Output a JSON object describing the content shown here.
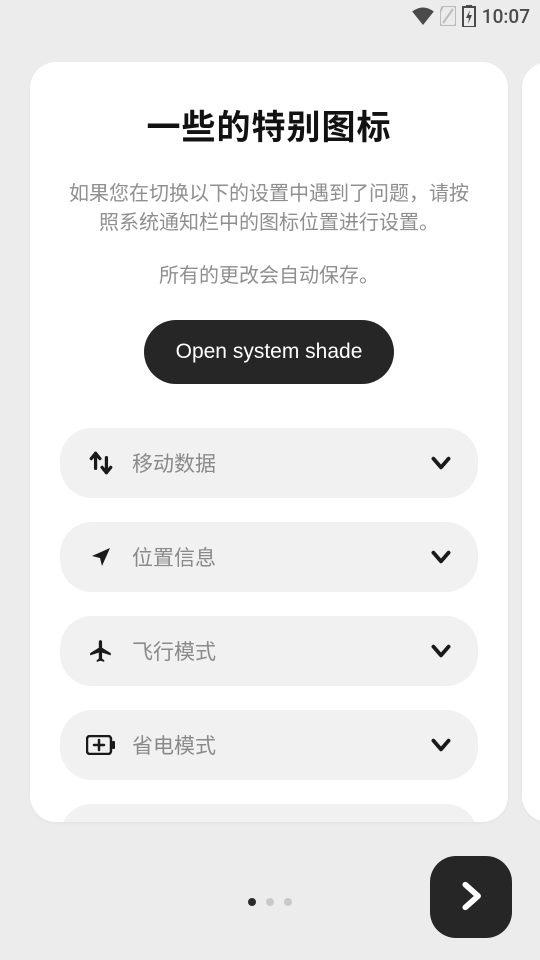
{
  "status": {
    "time": "10:07"
  },
  "card": {
    "title": "一些的特别图标",
    "desc1": "如果您在切换以下的设置中遇到了问题，请按照系统通知栏中的图标位置进行设置。",
    "desc2": "所有的更改会自动保存。",
    "open_label": "Open system shade"
  },
  "rows": [
    {
      "label": "移动数据"
    },
    {
      "label": "位置信息"
    },
    {
      "label": "飞行模式"
    },
    {
      "label": "省电模式"
    }
  ],
  "pager": {
    "current": 0,
    "count": 3
  }
}
